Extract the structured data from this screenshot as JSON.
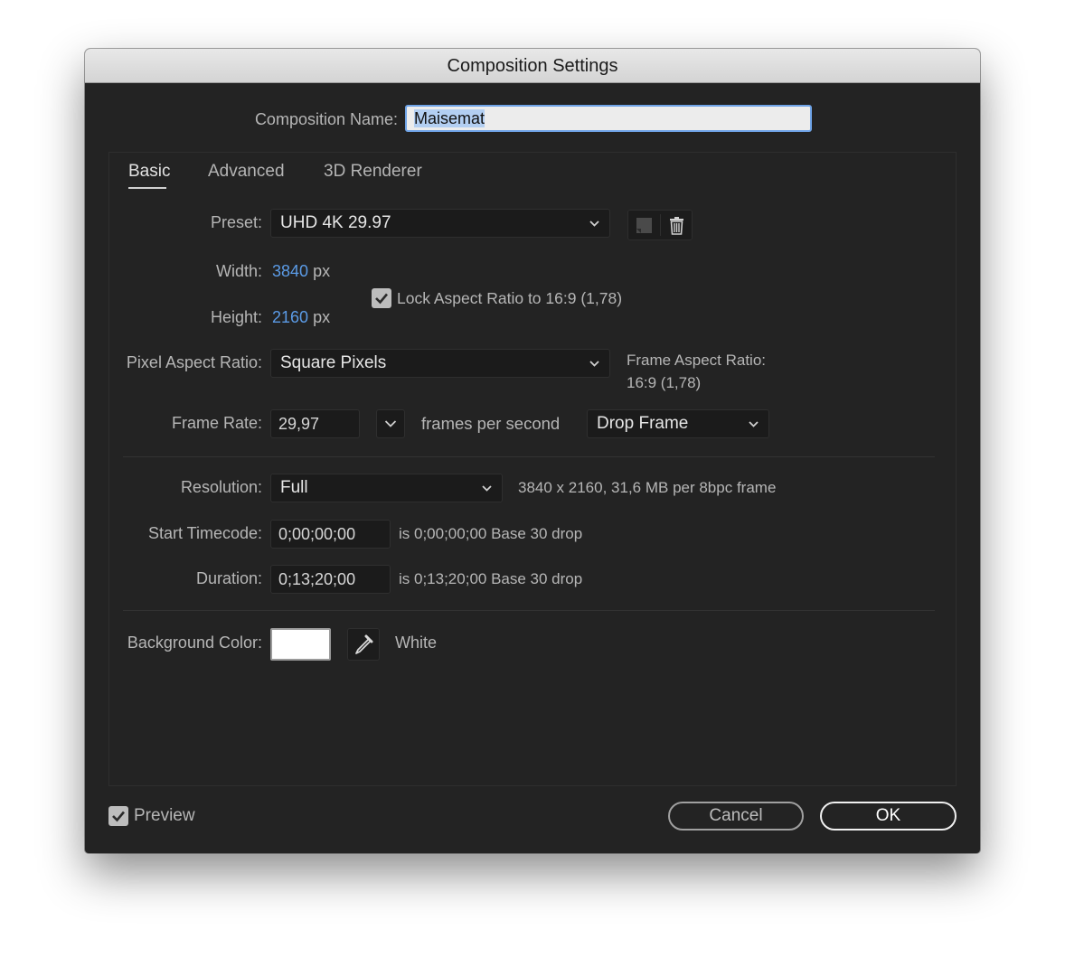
{
  "window": {
    "title": "Composition Settings"
  },
  "composition_name": {
    "label": "Composition Name:",
    "value": "Maisemat"
  },
  "tabs": [
    {
      "label": "Basic",
      "active": true
    },
    {
      "label": "Advanced",
      "active": false
    },
    {
      "label": "3D Renderer",
      "active": false
    }
  ],
  "preset": {
    "label": "Preset:",
    "value": "UHD 4K 29.97"
  },
  "width": {
    "label": "Width:",
    "value": "3840",
    "unit": "px"
  },
  "height": {
    "label": "Height:",
    "value": "2160",
    "unit": "px"
  },
  "lock_aspect": {
    "label": "Lock Aspect Ratio to 16:9 (1,78)",
    "checked": true
  },
  "pixel_aspect": {
    "label": "Pixel Aspect Ratio:",
    "value": "Square Pixels"
  },
  "frame_aspect": {
    "label": "Frame Aspect Ratio:",
    "value": "16:9 (1,78)"
  },
  "frame_rate": {
    "label": "Frame Rate:",
    "value": "29,97",
    "unit_label": "frames per second",
    "drop_mode": "Drop Frame"
  },
  "resolution": {
    "label": "Resolution:",
    "value": "Full",
    "info": "3840 x 2160, 31,6 MB per 8bpc frame"
  },
  "start_timecode": {
    "label": "Start Timecode:",
    "value": "0;00;00;00",
    "info": "is 0;00;00;00  Base 30  drop"
  },
  "duration": {
    "label": "Duration:",
    "value": "0;13;20;00",
    "info": "is 0;13;20;00  Base 30  drop"
  },
  "background": {
    "label": "Background Color:",
    "color": "#ffffff",
    "name": "White"
  },
  "footer": {
    "preview_label": "Preview",
    "preview_checked": true,
    "cancel_label": "Cancel",
    "ok_label": "OK"
  },
  "colors": {
    "dialog_bg": "#232323",
    "accent_blue": "#5b9be6",
    "field_bg": "#1b1b1b"
  }
}
